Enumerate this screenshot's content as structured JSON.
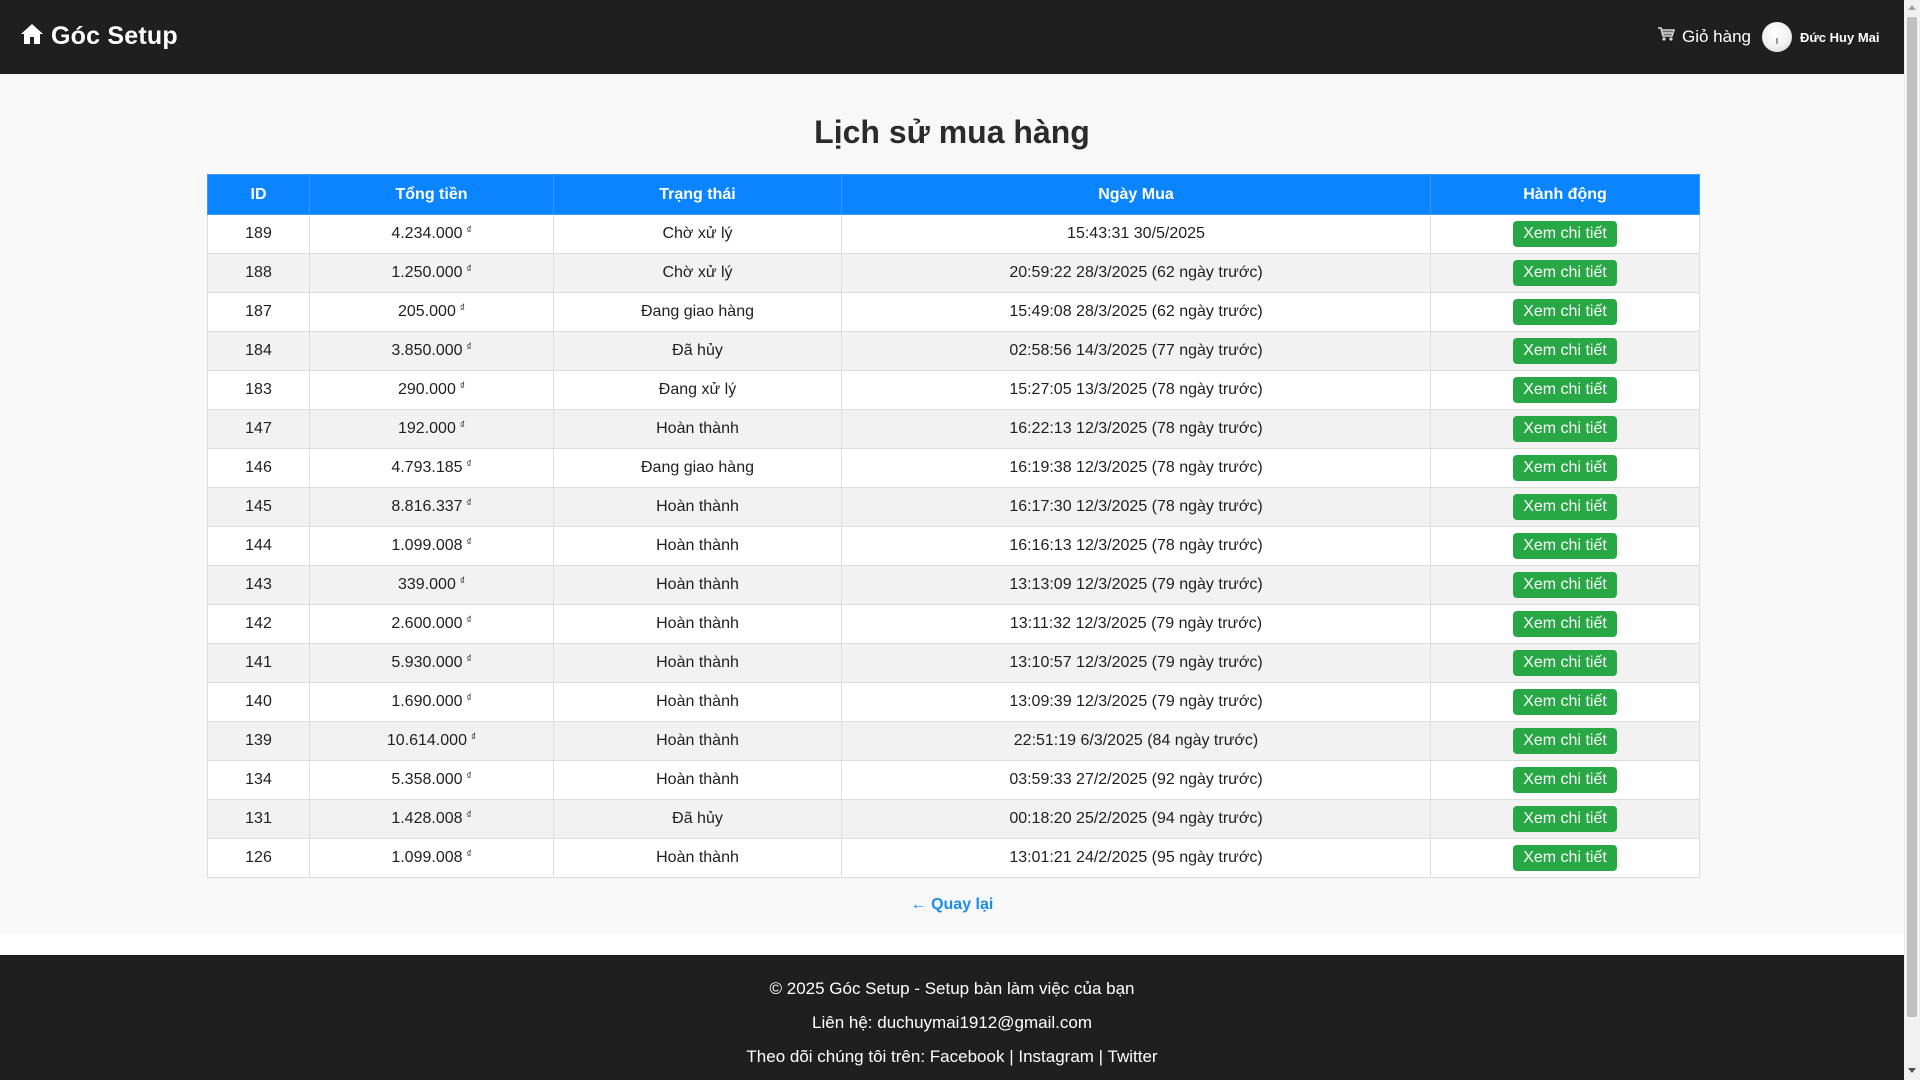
{
  "header": {
    "brand": "Góc Setup",
    "brand_icon": "home-icon",
    "cart_label": "Giỏ hàng",
    "cart_icon": "cart-icon",
    "user_name": "Đức Huy Mai"
  },
  "page": {
    "title": "Lịch sử mua hàng",
    "back_label": "← Quay lại"
  },
  "table": {
    "columns": [
      "ID",
      "Tổng tiền",
      "Trạng thái",
      "Ngày Mua",
      "Hành động"
    ],
    "currency_symbol": "₫",
    "action_label": "Xem chi tiết",
    "rows": [
      {
        "id": "189",
        "total": "4.234.000",
        "status": "Chờ xử lý",
        "date": "15:43:31 30/5/2025"
      },
      {
        "id": "188",
        "total": "1.250.000",
        "status": "Chờ xử lý",
        "date": "20:59:22 28/3/2025 (62 ngày trước)"
      },
      {
        "id": "187",
        "total": "205.000",
        "status": "Đang giao hàng",
        "date": "15:49:08 28/3/2025 (62 ngày trước)"
      },
      {
        "id": "184",
        "total": "3.850.000",
        "status": "Đã hủy",
        "date": "02:58:56 14/3/2025 (77 ngày trước)"
      },
      {
        "id": "183",
        "total": "290.000",
        "status": "Đang xử lý",
        "date": "15:27:05 13/3/2025 (78 ngày trước)"
      },
      {
        "id": "147",
        "total": "192.000",
        "status": "Hoàn thành",
        "date": "16:22:13 12/3/2025 (78 ngày trước)"
      },
      {
        "id": "146",
        "total": "4.793.185",
        "status": "Đang giao hàng",
        "date": "16:19:38 12/3/2025 (78 ngày trước)"
      },
      {
        "id": "145",
        "total": "8.816.337",
        "status": "Hoàn thành",
        "date": "16:17:30 12/3/2025 (78 ngày trước)"
      },
      {
        "id": "144",
        "total": "1.099.008",
        "status": "Hoàn thành",
        "date": "16:16:13 12/3/2025 (78 ngày trước)"
      },
      {
        "id": "143",
        "total": "339.000",
        "status": "Hoàn thành",
        "date": "13:13:09 12/3/2025 (79 ngày trước)"
      },
      {
        "id": "142",
        "total": "2.600.000",
        "status": "Hoàn thành",
        "date": "13:11:32 12/3/2025 (79 ngày trước)"
      },
      {
        "id": "141",
        "total": "5.930.000",
        "status": "Hoàn thành",
        "date": "13:10:57 12/3/2025 (79 ngày trước)"
      },
      {
        "id": "140",
        "total": "1.690.000",
        "status": "Hoàn thành",
        "date": "13:09:39 12/3/2025 (79 ngày trước)"
      },
      {
        "id": "139",
        "total": "10.614.000",
        "status": "Hoàn thành",
        "date": "22:51:19 6/3/2025 (84 ngày trước)"
      },
      {
        "id": "134",
        "total": "5.358.000",
        "status": "Hoàn thành",
        "date": "03:59:33 27/2/2025 (92 ngày trước)"
      },
      {
        "id": "131",
        "total": "1.428.008",
        "status": "Đã hủy",
        "date": "00:18:20 25/2/2025 (94 ngày trước)"
      },
      {
        "id": "126",
        "total": "1.099.008",
        "status": "Hoàn thành",
        "date": "13:01:21 24/2/2025 (95 ngày trước)"
      }
    ]
  },
  "footer": {
    "copyright": "© 2025 Góc Setup - Setup bàn làm việc của bạn",
    "contact": "Liên hệ: duchuymai1912@gmail.com",
    "follow_prefix": "Theo dõi chúng tôi trên:",
    "social": [
      "Facebook",
      "Instagram",
      "Twitter"
    ],
    "separator": "|"
  },
  "colors": {
    "header_bg": "#1f1f1f",
    "table_header_bg": "#0a84ff",
    "action_button_bg": "#28a745",
    "back_link": "#1a8de9"
  }
}
